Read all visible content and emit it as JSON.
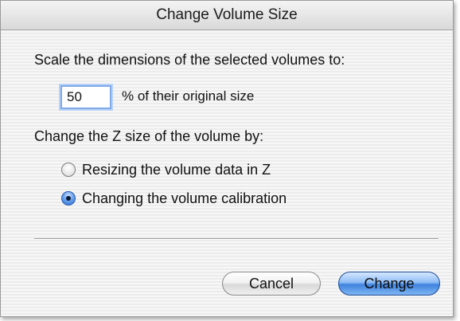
{
  "dialog": {
    "title": "Change Volume Size",
    "scale_prompt": "Scale the dimensions of the selected volumes to:",
    "percent_value": "50",
    "percent_suffix": "% of their original size",
    "z_prompt": "Change the Z size of the volume by:",
    "options": [
      {
        "label": "Resizing the volume data in Z",
        "selected": false
      },
      {
        "label": "Changing the volume calibration",
        "selected": true
      }
    ],
    "buttons": {
      "cancel": "Cancel",
      "change": "Change"
    },
    "colors": {
      "accent": "#3f82de",
      "field_focus": "#7fa9e8"
    }
  }
}
